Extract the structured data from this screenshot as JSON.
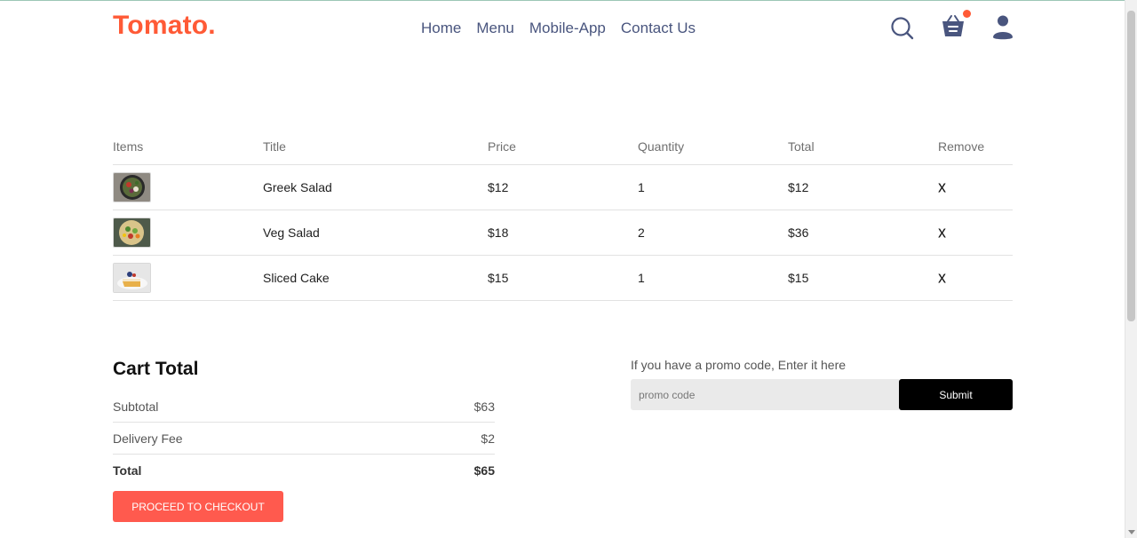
{
  "brand": {
    "logo": "Tomato.",
    "accent": "#ff5a36"
  },
  "nav": {
    "items": [
      {
        "label": "Home"
      },
      {
        "label": "Menu"
      },
      {
        "label": "Mobile-App"
      },
      {
        "label": "Contact Us"
      }
    ]
  },
  "header_icons": [
    "search-icon",
    "basket-icon",
    "profile-icon"
  ],
  "cart": {
    "headers": [
      "Items",
      "Title",
      "Price",
      "Quantity",
      "Total",
      "Remove"
    ],
    "rows": [
      {
        "image": "greek-salad",
        "title": "Greek Salad",
        "price": "$12",
        "quantity": "1",
        "total": "$12",
        "remove": "x"
      },
      {
        "image": "veg-salad",
        "title": "Veg Salad",
        "price": "$18",
        "quantity": "2",
        "total": "$36",
        "remove": "x"
      },
      {
        "image": "sliced-cake",
        "title": "Sliced Cake",
        "price": "$15",
        "quantity": "1",
        "total": "$15",
        "remove": "x"
      }
    ]
  },
  "cart_total": {
    "title": "Cart Total",
    "subtotal_label": "Subtotal",
    "subtotal_value": "$63",
    "delivery_label": "Delivery Fee",
    "delivery_value": "$2",
    "total_label": "Total",
    "total_value": "$65",
    "checkout_label": "PROCEED TO CHECKOUT"
  },
  "promo": {
    "prompt": "If you have a promo code, Enter it here",
    "placeholder": "promo code",
    "submit_label": "Submit"
  }
}
